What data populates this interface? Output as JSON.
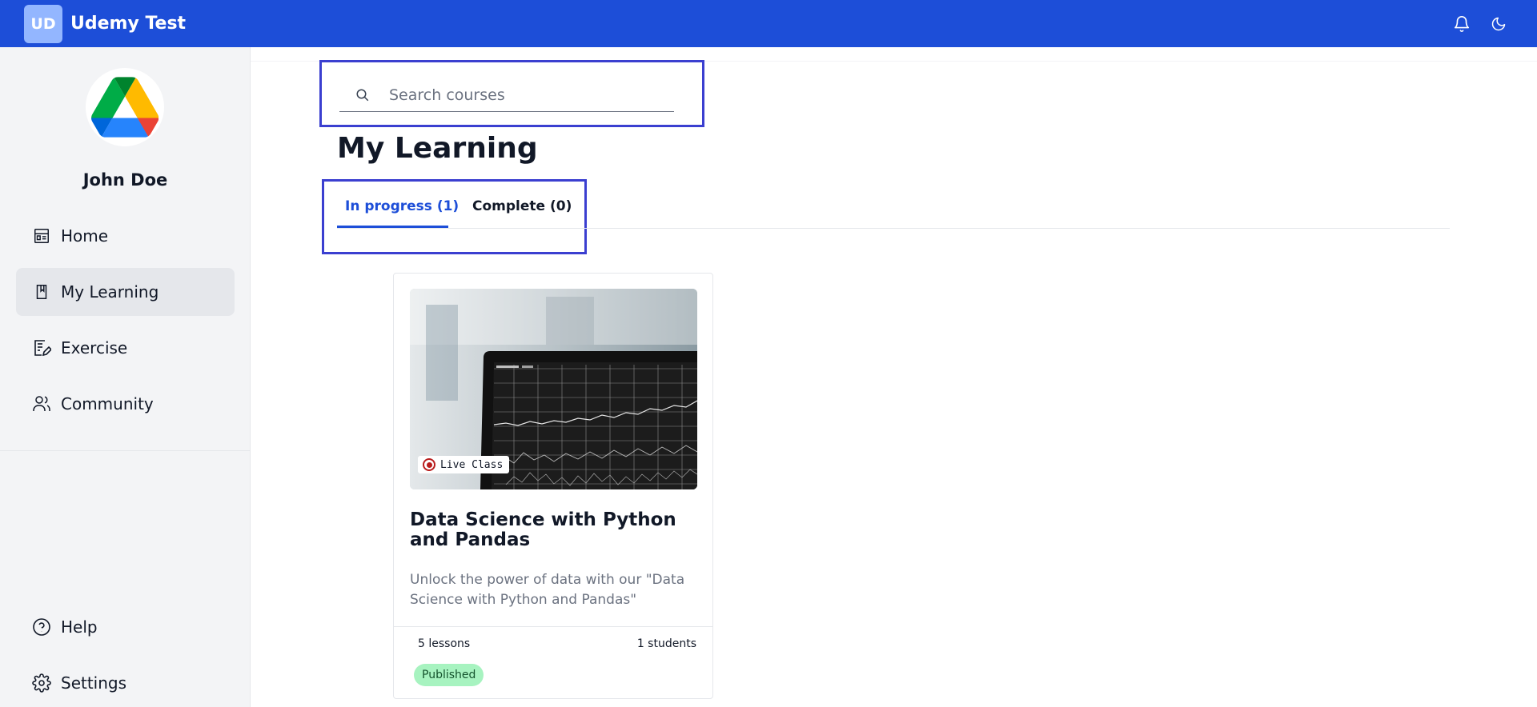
{
  "header": {
    "logo_initials": "UD",
    "app_title": "Udemy Test",
    "icons": [
      "bell-icon",
      "moon-icon"
    ]
  },
  "sidebar": {
    "user_name": "John Doe",
    "avatar_icon": "google-drive-logo",
    "items": [
      {
        "label": "Home",
        "icon": "calendar-icon",
        "active": false
      },
      {
        "label": "My Learning",
        "icon": "bookmark-book-icon",
        "active": true
      },
      {
        "label": "Exercise",
        "icon": "document-edit-icon",
        "active": false
      },
      {
        "label": "Community",
        "icon": "users-icon",
        "active": false
      }
    ],
    "bottom_items": [
      {
        "label": "Help",
        "icon": "help-circle-icon"
      },
      {
        "label": "Settings",
        "icon": "gear-icon"
      }
    ]
  },
  "search": {
    "placeholder": "Search courses",
    "value": ""
  },
  "page": {
    "title": "My Learning"
  },
  "tabs": [
    {
      "label": "In progress (1)",
      "active": true
    },
    {
      "label": "Complete (0)",
      "active": false
    }
  ],
  "courses": [
    {
      "badge": "Live Class",
      "title": "Data Science with Python and Pandas",
      "description": "Unlock the power of data with our \"Data Science with Python and Pandas\" course....",
      "lessons": "5 lessons",
      "students": "1 students",
      "status": "Published"
    }
  ],
  "colors": {
    "brand": "#1d4ed8",
    "annotation_box": "#3b3fd0",
    "published_bg": "#a7f3c0"
  }
}
